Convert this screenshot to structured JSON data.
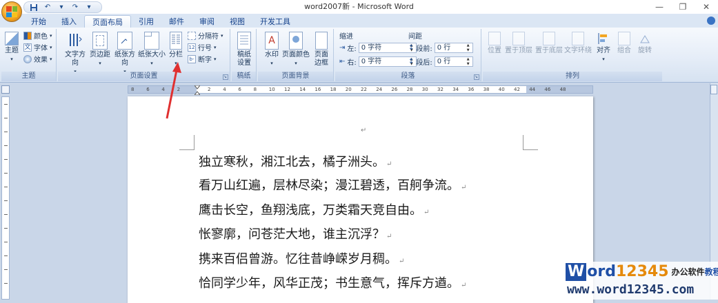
{
  "window": {
    "title": "word2007新 - Microsoft Word",
    "minimize": "—",
    "restore": "❐",
    "close": "✕"
  },
  "qat": {
    "save_icon": "save-icon",
    "undo_label": "↶",
    "undo_more": "▾",
    "redo_label": "↷",
    "customize": "▾"
  },
  "tabs": [
    "开始",
    "插入",
    "页面布局",
    "引用",
    "邮件",
    "审阅",
    "视图",
    "开发工具"
  ],
  "active_tab": "页面布局",
  "ribbon": {
    "theme_group": {
      "label": "主题",
      "theme_button": "主题",
      "colors": "颜色",
      "fonts": "字体",
      "effects": "效果"
    },
    "page_setup_group": {
      "label": "页面设置",
      "text_direction": "文字方向",
      "margins": "页边距",
      "orientation": "纸张方向",
      "size": "纸张大小",
      "columns": "分栏",
      "breaks": "分隔符",
      "line_numbers": "行号",
      "hyphenation": "断字"
    },
    "manuscript_group": {
      "label": "稿纸",
      "button": "稿纸设置"
    },
    "page_background_group": {
      "label": "页面背景",
      "watermark": "水印",
      "page_color": "页面颜色",
      "page_borders": "页面边框"
    },
    "paragraph_group": {
      "label": "段落",
      "indent_title": "缩进",
      "spacing_title": "间距",
      "indent_left_label": "左:",
      "indent_left_value": "0 字符",
      "indent_right_label": "右:",
      "indent_right_value": "0 字符",
      "spacing_before_label": "段前:",
      "spacing_before_value": "0 行",
      "spacing_after_label": "段后:",
      "spacing_after_value": "0 行"
    },
    "arrange_group": {
      "label": "排列",
      "position": "位置",
      "bring_front": "置于顶层",
      "send_back": "置于底层",
      "text_wrap": "文字环绕",
      "align": "对齐",
      "group": "组合",
      "rotate": "旋转"
    }
  },
  "ruler_ticks": [
    "8",
    "6",
    "4",
    "2",
    "",
    "2",
    "4",
    "6",
    "8",
    "10",
    "12",
    "14",
    "16",
    "18",
    "20",
    "22",
    "24",
    "26",
    "28",
    "30",
    "32",
    "34",
    "36",
    "38",
    "40",
    "42",
    "44",
    "46",
    "48"
  ],
  "document": {
    "lines": [
      "独立寒秋，湘江北去，橘子洲头。",
      "看万山红遍，层林尽染；漫江碧透，百舸争流。",
      "鹰击长空，鱼翔浅底，万类霜天竞自由。",
      "怅寥廓，问苍茫大地，谁主沉浮？",
      "携来百侣曾游。忆往昔峥嵘岁月稠。",
      "恰同学少年，风华正茂；书生意气，挥斥方遒。"
    ],
    "paragraph_mark": "↵"
  },
  "watermark": {
    "w": "W",
    "ord": "ord",
    "num": "12345",
    "cn1": "办公软件",
    "cn2": "教程",
    "url": "www.word12345.com"
  },
  "colors": {
    "accent": "#1f4fa6",
    "arrow": "#e03030",
    "tab_text": "#15428b"
  }
}
